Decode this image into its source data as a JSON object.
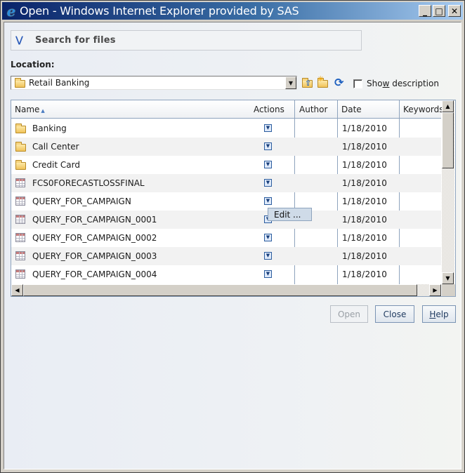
{
  "window": {
    "title": "Open - Windows Internet Explorer provided by SAS",
    "icon": "internet-explorer-icon",
    "controls": {
      "minimize": "_",
      "maximize": "□",
      "close": "✕"
    }
  },
  "search": {
    "label": "Search for files",
    "icon": "double-chevron-down-icon"
  },
  "location": {
    "label": "Location:",
    "value": "Retail Banking",
    "icons": [
      "up-folder-icon",
      "new-folder-icon",
      "refresh-icon"
    ]
  },
  "show_description": {
    "label_pre": "Sho",
    "label_u": "w",
    "label_post": " description",
    "checked": false
  },
  "grid": {
    "columns": [
      {
        "label": "Name",
        "sorted": "ascending"
      },
      {
        "label": "Actions"
      },
      {
        "label": "Author"
      },
      {
        "label": "Date"
      },
      {
        "label": "Keywords"
      }
    ],
    "rows": [
      {
        "type": "folder",
        "name": "Banking",
        "author": "",
        "date": "1/18/2010",
        "keywords": ""
      },
      {
        "type": "folder",
        "name": "Call Center",
        "author": "",
        "date": "1/18/2010",
        "keywords": ""
      },
      {
        "type": "folder",
        "name": "Credit Card",
        "author": "",
        "date": "1/18/2010",
        "keywords": ""
      },
      {
        "type": "table",
        "name": "FCS0FORECASTLOSSFINAL",
        "author": "",
        "date": "1/18/2010",
        "keywords": ""
      },
      {
        "type": "table",
        "name": "QUERY_FOR_CAMPAIGN",
        "author": "",
        "date": "1/18/2010",
        "keywords": ""
      },
      {
        "type": "table",
        "name": "QUERY_FOR_CAMPAIGN_0001",
        "author": "",
        "date": "1/18/2010",
        "keywords": ""
      },
      {
        "type": "table",
        "name": "QUERY_FOR_CAMPAIGN_0002",
        "author": "",
        "date": "1/18/2010",
        "keywords": ""
      },
      {
        "type": "table",
        "name": "QUERY_FOR_CAMPAIGN_0003",
        "author": "",
        "date": "1/18/2010",
        "keywords": ""
      },
      {
        "type": "table",
        "name": "QUERY_FOR_CAMPAIGN_0004",
        "author": "",
        "date": "1/18/2010",
        "keywords": ""
      }
    ]
  },
  "context_menu": {
    "items": [
      "Edit ..."
    ]
  },
  "buttons": {
    "open": {
      "label": "Open",
      "enabled": false
    },
    "close": {
      "label": "Close",
      "enabled": true
    },
    "help": {
      "label_u": "H",
      "label_rest": "elp",
      "enabled": true
    }
  }
}
